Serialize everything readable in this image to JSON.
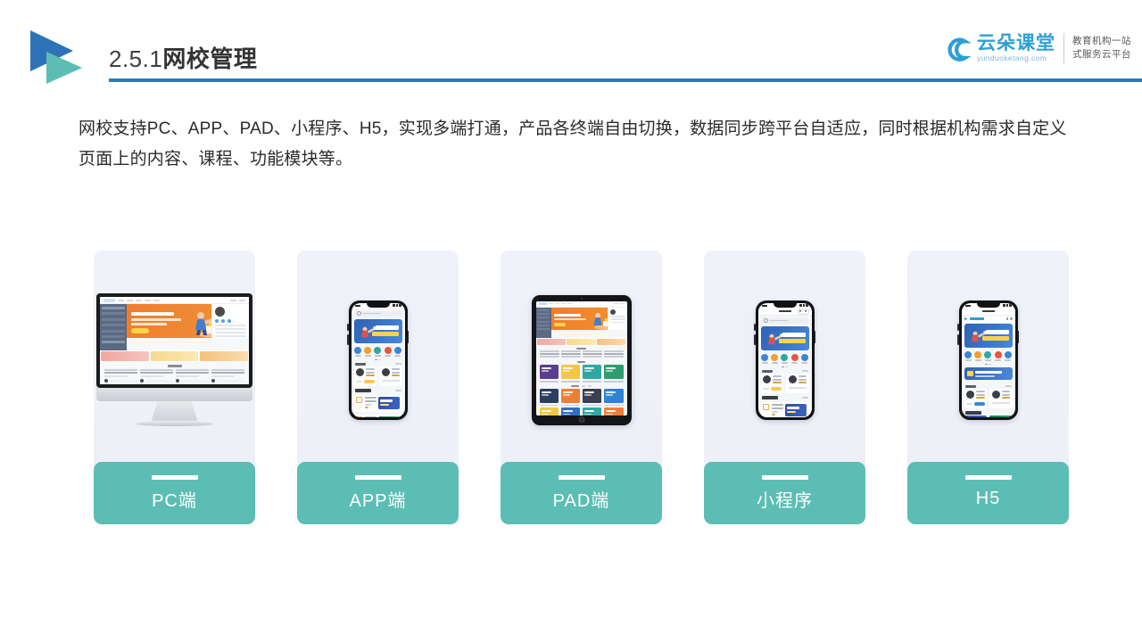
{
  "header": {
    "section_number": "2.5.1",
    "title_cn": "网校管理",
    "rule_color": "#3279b8"
  },
  "brand": {
    "name_cn": "云朵课堂",
    "url": "yunduoketang.com",
    "tagline_line1": "教育机构一站",
    "tagline_line2": "式服务云平台",
    "color": "#2e9fd4"
  },
  "body": {
    "paragraph": "网校支持PC、APP、PAD、小程序、H5，实现多端打通，产品各终端自由切换，数据同步跨平台自适应，同时根据机构需求自定义页面上的内容、课程、功能模块等。"
  },
  "cards": {
    "label_color": "#5cbdb4",
    "stage_color": "#eef1f8",
    "items": [
      {
        "label": "PC端",
        "device": "desktop"
      },
      {
        "label": "APP端",
        "device": "phone"
      },
      {
        "label": "PAD端",
        "device": "tablet"
      },
      {
        "label": "小程序",
        "device": "phone-miniprogram"
      },
      {
        "label": "H5",
        "device": "phone-h5"
      }
    ]
  },
  "mock_ui": {
    "hero_banner_color": "#f0892f",
    "phone_banner_color": "#2f62b4",
    "tile_colors": [
      "#5b3f8e",
      "#f2c744",
      "#2fa8a0",
      "#2f9e6e",
      "#2b3f63",
      "#ef7f36",
      "#3a3f52",
      "#2f83d6",
      "#f2c744",
      "#2f6fc4",
      "#2fa8a0",
      "#ef7f36"
    ],
    "promo_colors": [
      "#f3a7a0",
      "#f6d98a",
      "#f5c17a"
    ],
    "category_colors": [
      "#3a86d8",
      "#f0a12c",
      "#2fa8a0",
      "#e8563f",
      "#3a86d8"
    ]
  }
}
